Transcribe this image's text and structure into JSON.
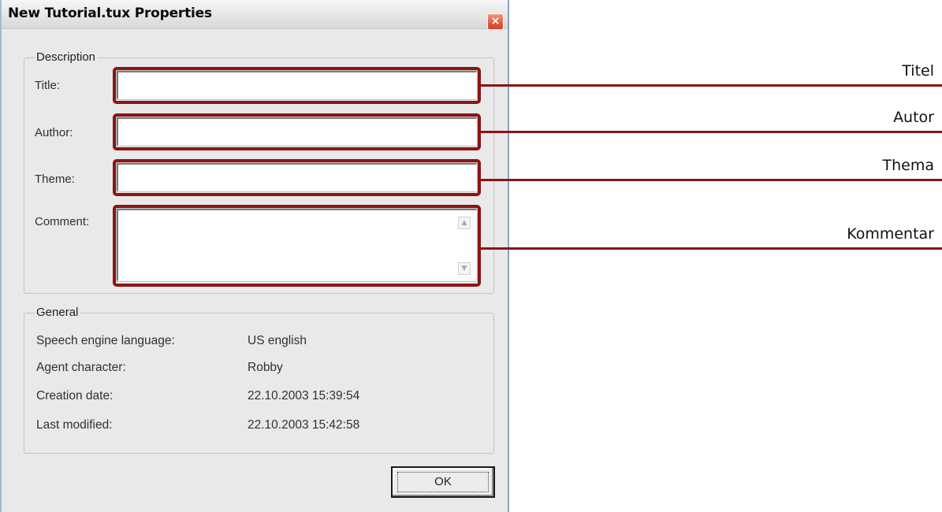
{
  "window": {
    "title": "New Tutorial.tux Properties",
    "close_glyph": "×"
  },
  "description": {
    "legend": "Description",
    "fields": [
      {
        "label": "Title:",
        "value": ""
      },
      {
        "label": "Author:",
        "value": ""
      },
      {
        "label": "Theme:",
        "value": ""
      },
      {
        "label": "Comment:",
        "value": ""
      }
    ],
    "scroll_up_glyph": "▲",
    "scroll_down_glyph": "▼"
  },
  "general": {
    "legend": "General",
    "rows": [
      {
        "label": "Speech engine language:",
        "value": "US english"
      },
      {
        "label": "Agent character:",
        "value": "Robby"
      },
      {
        "label": "Creation date:",
        "value": "22.10.2003 15:39:54"
      },
      {
        "label": "Last modified:",
        "value": "22.10.2003 15:42:58"
      }
    ]
  },
  "buttons": {
    "ok_label": "OK"
  },
  "callouts": [
    {
      "text": "Titel"
    },
    {
      "text": "Autor"
    },
    {
      "text": "Thema"
    },
    {
      "text": "Kommentar"
    }
  ],
  "colors": {
    "callout_red": "#8b1414",
    "close_button": "#e0593d",
    "dialog_bg": "#e9e9e9"
  },
  "icons": {
    "close": "close-icon",
    "scroll_up": "chevron-up-icon",
    "scroll_down": "chevron-down-icon"
  }
}
